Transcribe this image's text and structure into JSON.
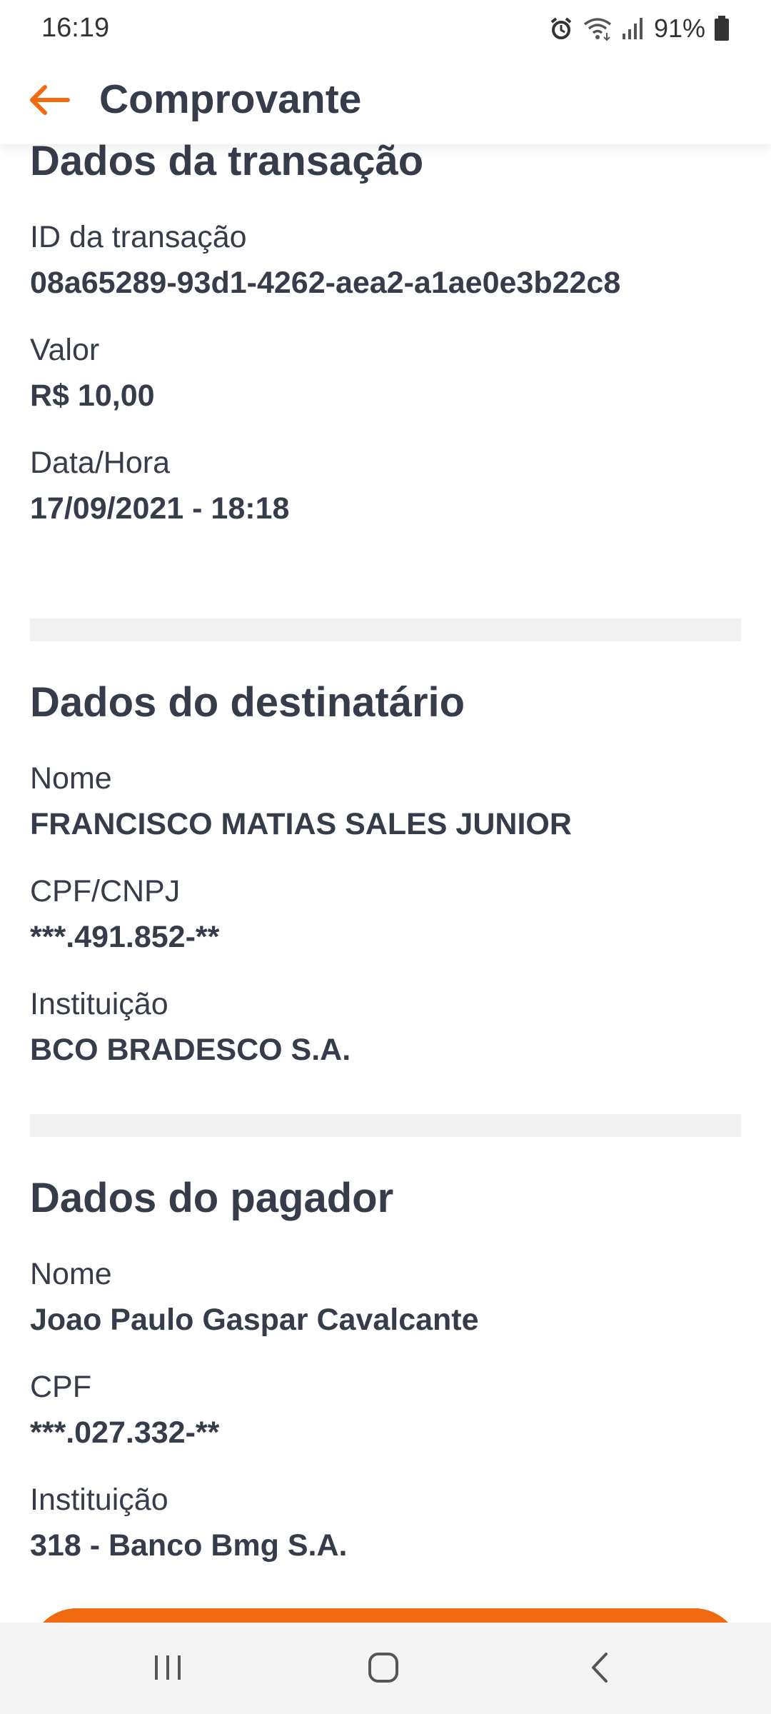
{
  "status_bar": {
    "time": "16:19",
    "battery": "91%",
    "icons": [
      "alarm-icon",
      "wifi-icon",
      "signal-icon",
      "battery-icon"
    ]
  },
  "header": {
    "title": "Comprovante",
    "back_icon": "arrow-left-icon"
  },
  "colors": {
    "accent": "#f26a10",
    "text": "#363c4a",
    "divider": "#f1f1f1"
  },
  "transaction": {
    "title": "Dados da transação",
    "id_label": "ID da transação",
    "id_value": "08a65289-93d1-4262-aea2-a1ae0e3b22c8",
    "amount_label": "Valor",
    "amount_value": "R$ 10,00",
    "datetime_label": "Data/Hora",
    "datetime_value": "17/09/2021 - 18:18"
  },
  "recipient": {
    "title": "Dados do destinatário",
    "name_label": "Nome",
    "name_value": "FRANCISCO MATIAS SALES JUNIOR",
    "doc_label": "CPF/CNPJ",
    "doc_value": "***.491.852-**",
    "bank_label": "Instituição",
    "bank_value": "BCO BRADESCO S.A."
  },
  "payer": {
    "title": "Dados do pagador",
    "name_label": "Nome",
    "name_value": "Joao Paulo Gaspar Cavalcante",
    "doc_label": "CPF",
    "doc_value": "***.027.332-**",
    "bank_label": "Instituição",
    "bank_value": "318 - Banco Bmg S.A."
  },
  "nav_bar": {
    "icons": [
      "recent-apps-icon",
      "home-icon",
      "back-icon"
    ]
  }
}
